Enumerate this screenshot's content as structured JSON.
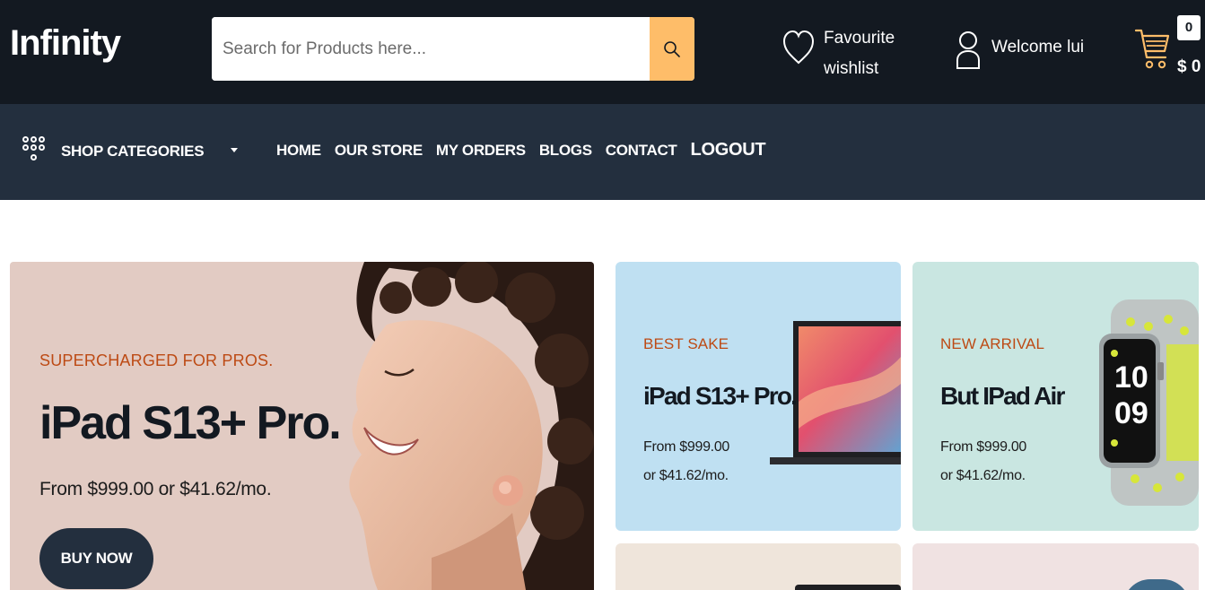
{
  "header": {
    "logo": "Infinity",
    "search_placeholder": "Search for Products here...",
    "favourite": {
      "line1": "Favourite",
      "line2": "wishlist"
    },
    "account": "Welcome lui",
    "cart": {
      "count": "0",
      "total": "$ 0"
    }
  },
  "nav": {
    "categories_label": "SHOP CATEGORIES",
    "links": [
      "HOME",
      "OUR STORE",
      "MY ORDERS",
      "BLOGS",
      "CONTACT",
      "LOGOUT"
    ]
  },
  "hero": {
    "subtitle": "SUPERCHARGED FOR PROS.",
    "title": "iPad S13+ Pro.",
    "price": "From $999.00 or $41.62/mo.",
    "button": "BUY NOW"
  },
  "cards": [
    {
      "subtitle": "BEST SAKE",
      "title": "iPad S13+ Pro.",
      "price_line1": "From $999.00",
      "price_line2": "or $41.62/mo."
    },
    {
      "subtitle": "NEW ARRIVAL",
      "title": "But IPad Air",
      "price_line1": "From $999.00",
      "price_line2": "or $41.62/mo."
    }
  ],
  "colors": {
    "topbar": "#131921",
    "navbar": "#232f3e",
    "accent": "#febd69",
    "subtitle": "#bd4a14",
    "hero_bg": "#e2cbc3",
    "card1_bg": "#bfe0f2",
    "card2_bg": "#c9e6e1",
    "card3_bg": "#efe5db",
    "card4_bg": "#f0e2e2"
  },
  "icons": [
    "search-icon",
    "heart-icon",
    "user-icon",
    "cart-icon",
    "grid-dots-icon",
    "caret-down-icon"
  ]
}
